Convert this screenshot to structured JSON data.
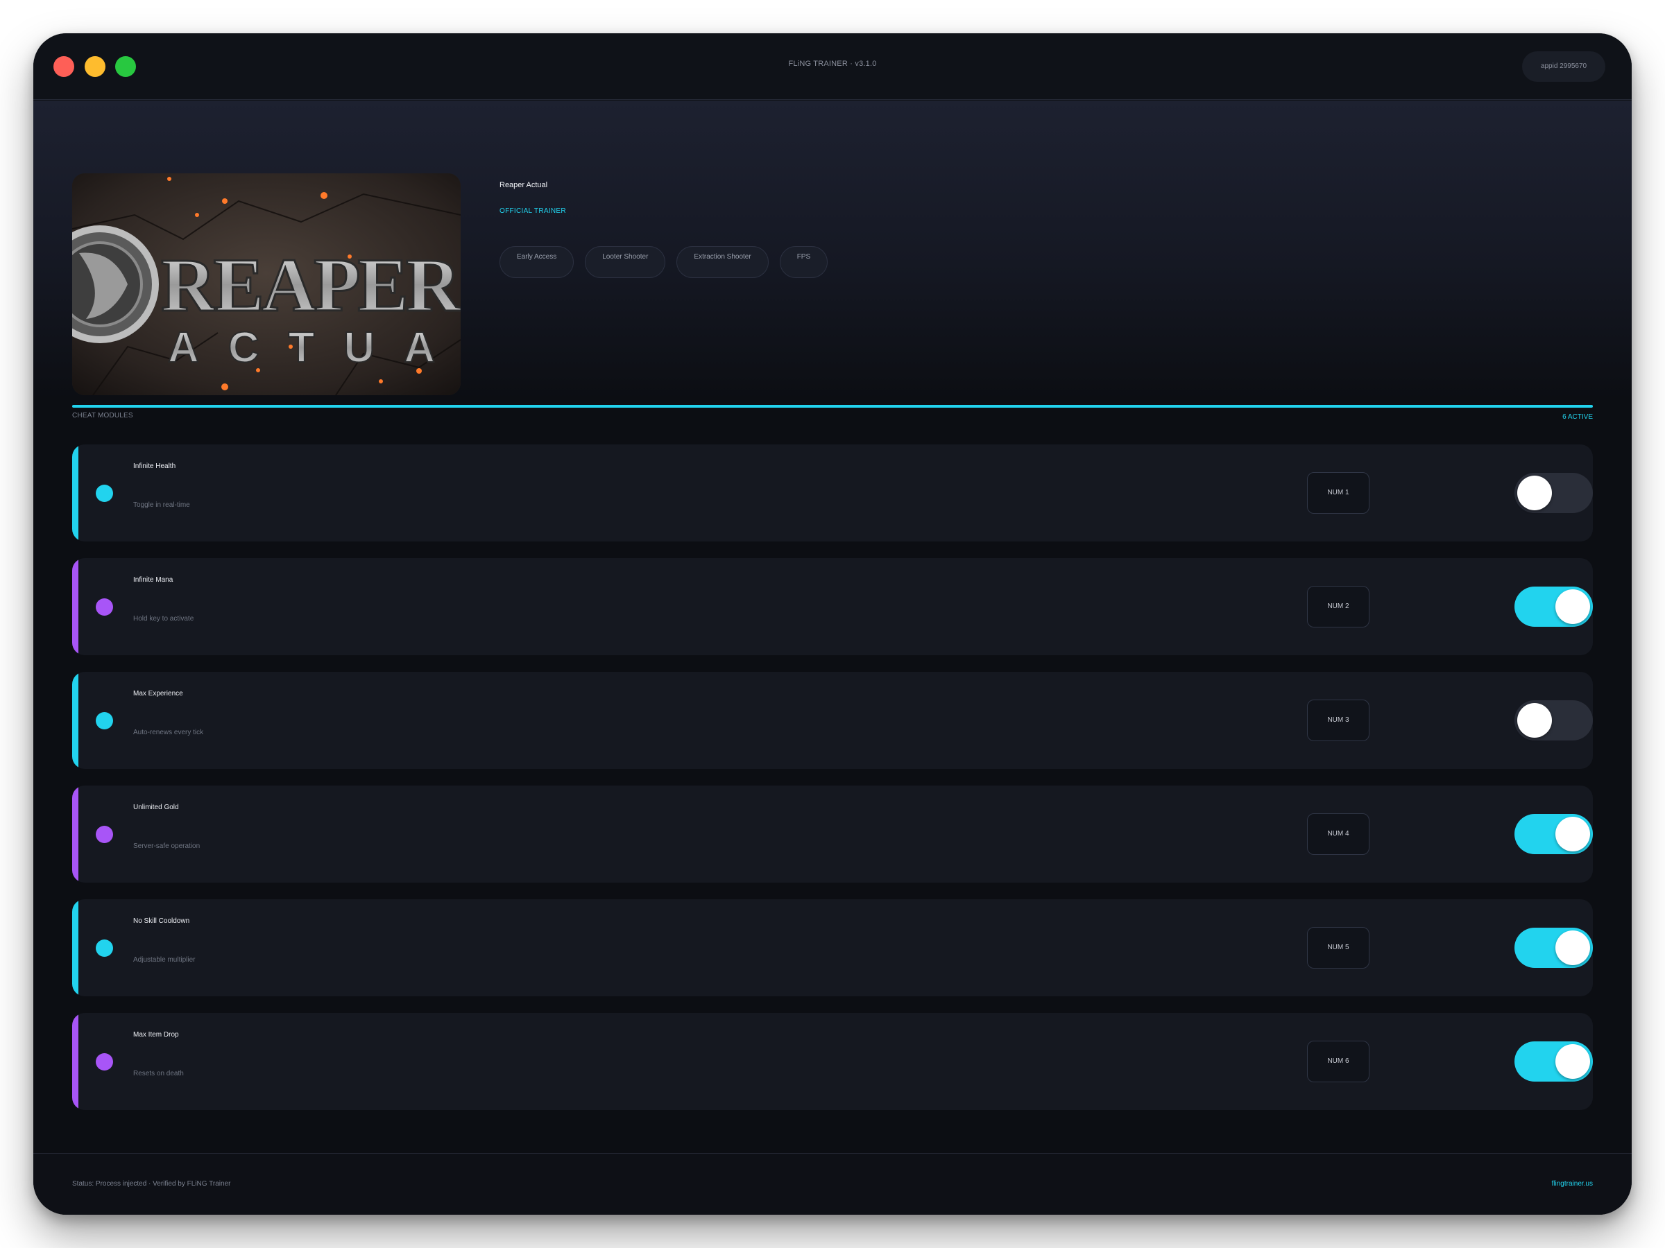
{
  "window": {
    "title": "FLiNG TRAINER · v3.1.0",
    "appid": "appid 2995670"
  },
  "game": {
    "title": "Reaper Actual",
    "badge": "OFFICIAL TRAINER",
    "cover_art_text": [
      "REAPER",
      "ACTUAL"
    ],
    "tags": [
      "Early Access",
      "Looter Shooter",
      "Extraction Shooter",
      "FPS"
    ]
  },
  "section": {
    "label": "CHEAT MODULES",
    "active_count": "6 ACTIVE"
  },
  "colors": {
    "accent_cyan": "#22d3ee",
    "accent_purple": "#a855f7",
    "background": "#0c0e13",
    "card": "#151820"
  },
  "modules": [
    {
      "name": "Infinite Health",
      "desc": "Toggle in real-time",
      "hotkey": "NUM 1",
      "enabled": false,
      "accent": "#22d3ee"
    },
    {
      "name": "Infinite Mana",
      "desc": "Hold key to activate",
      "hotkey": "NUM 2",
      "enabled": true,
      "accent": "#a855f7"
    },
    {
      "name": "Max Experience",
      "desc": "Auto-renews every tick",
      "hotkey": "NUM 3",
      "enabled": false,
      "accent": "#22d3ee"
    },
    {
      "name": "Unlimited Gold",
      "desc": "Server-safe operation",
      "hotkey": "NUM 4",
      "enabled": true,
      "accent": "#a855f7"
    },
    {
      "name": "No Skill Cooldown",
      "desc": "Adjustable multiplier",
      "hotkey": "NUM 5",
      "enabled": true,
      "accent": "#22d3ee"
    },
    {
      "name": "Max Item Drop",
      "desc": "Resets on death",
      "hotkey": "NUM 6",
      "enabled": true,
      "accent": "#a855f7"
    }
  ],
  "footer": {
    "status": "Status: Process injected · Verified by FLiNG Trainer",
    "link": "flingtrainer.us"
  }
}
